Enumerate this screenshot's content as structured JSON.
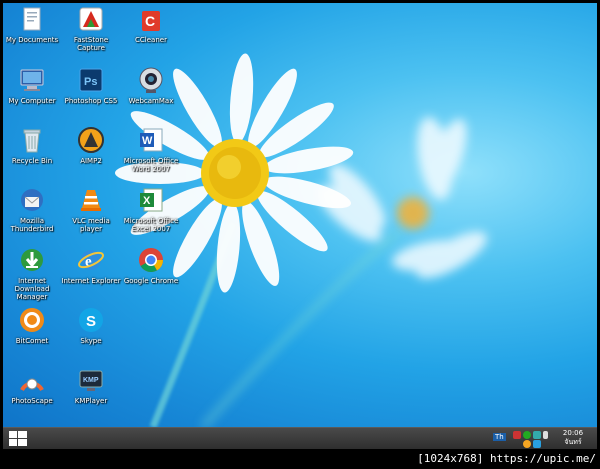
{
  "desktop": {
    "icons": [
      {
        "label": "My Documents",
        "icon": "documents-icon"
      },
      {
        "label": "FastStone Capture",
        "icon": "faststone-capture-icon"
      },
      {
        "label": "CCleaner",
        "icon": "ccleaner-icon"
      },
      {
        "label": "My Computer",
        "icon": "computer-icon"
      },
      {
        "label": "Photoshop CS5",
        "icon": "photoshop-icon"
      },
      {
        "label": "WebcamMax",
        "icon": "webcammax-icon"
      },
      {
        "label": "Recycle Bin",
        "icon": "recycle-bin-icon"
      },
      {
        "label": "AIMP2",
        "icon": "aimp-icon"
      },
      {
        "label": "Microsoft Office Word 2007",
        "icon": "word-icon"
      },
      {
        "label": "Mozilla Thunderbird",
        "icon": "thunderbird-icon"
      },
      {
        "label": "VLC media player",
        "icon": "vlc-icon"
      },
      {
        "label": "Microsoft Office Excel 2007",
        "icon": "excel-icon"
      },
      {
        "label": "Internet Download Manager",
        "icon": "idm-icon"
      },
      {
        "label": "Internet Explorer",
        "icon": "internet-explorer-icon"
      },
      {
        "label": "Google Chrome",
        "icon": "chrome-icon"
      },
      {
        "label": "BitComet",
        "icon": "bitcomet-icon"
      },
      {
        "label": "Skype",
        "icon": "skype-icon"
      },
      {
        "label": "PhotoScape",
        "icon": "photoscape-icon"
      },
      {
        "label": "KMPlayer",
        "icon": "kmplayer-icon"
      }
    ]
  },
  "taskbar": {
    "start_icon": "windows-logo-icon",
    "language": "Th",
    "clock_time": "20:06",
    "clock_day": "จันทร์"
  },
  "watermark": "[1024x768] https://upic.me/"
}
